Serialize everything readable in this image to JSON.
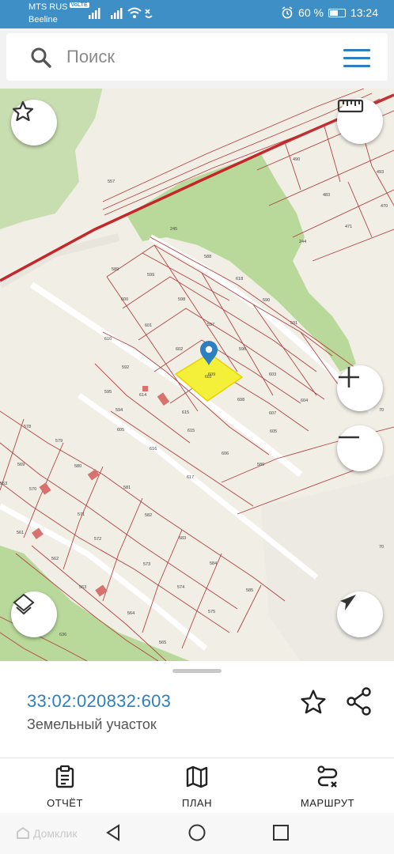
{
  "status_bar": {
    "carrier_primary": "MTS RUS",
    "volte": "VoLTE",
    "carrier_secondary": "Beeline",
    "battery": "60 %",
    "battery_level": 0.6,
    "time": "13:24"
  },
  "search": {
    "placeholder": "Поиск"
  },
  "map": {
    "parcel_labels": [
      "490",
      "493",
      "483",
      "470",
      "471",
      "245",
      "244",
      "588",
      "589",
      "599",
      "618",
      "600",
      "598",
      "590",
      "601",
      "597",
      "591",
      "610",
      "602",
      "596",
      "592",
      "609",
      "603",
      "595",
      "614",
      "608",
      "604",
      "594",
      "615",
      "607",
      "605",
      "605",
      "615",
      "616",
      "606",
      "578",
      "579",
      "580",
      "589",
      "569",
      "570",
      "581",
      "617",
      "553",
      "571",
      "561",
      "572",
      "582",
      "583",
      "562",
      "573",
      "584",
      "563",
      "574",
      "585",
      "564",
      "575",
      "565",
      "636",
      "70",
      "70",
      "557"
    ],
    "selected_parcel": "603",
    "accent_color": "#2d7fc1",
    "selection_color": "#f4f03a"
  },
  "parcel": {
    "cadastral_number": "33:02:020832:603",
    "type": "Земельный участок"
  },
  "actions": [
    {
      "icon": "report-icon",
      "label": "ОТЧЁТ"
    },
    {
      "icon": "map-plan-icon",
      "label": "ПЛАН"
    },
    {
      "icon": "route-icon",
      "label": "МАРШРУТ"
    }
  ],
  "watermark": "Домклик"
}
